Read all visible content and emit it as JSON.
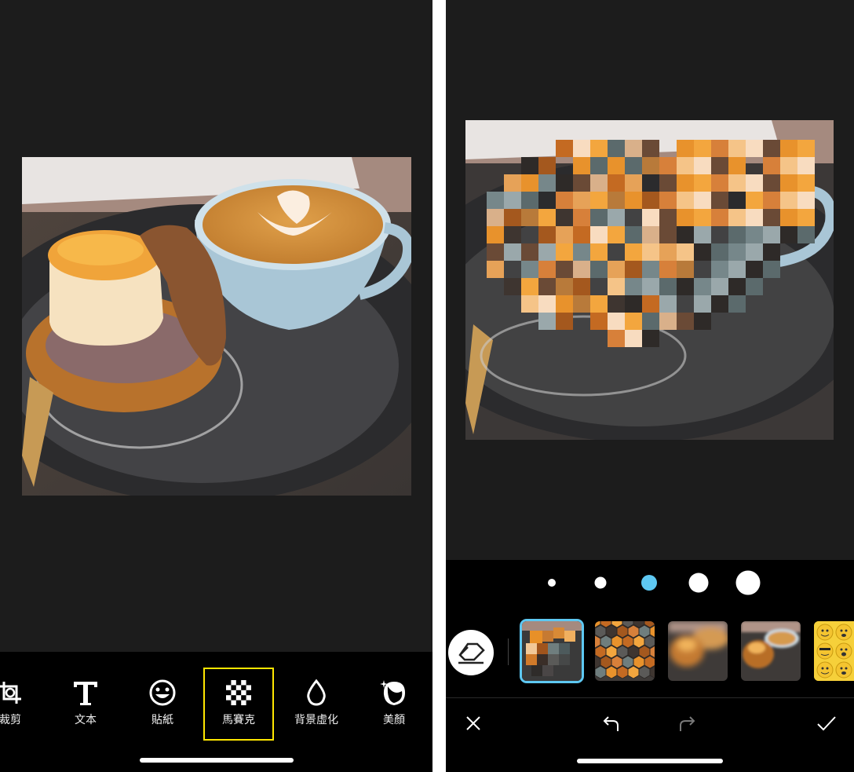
{
  "left_screen": {
    "toolbar": [
      {
        "label": "裁剪",
        "icon": "crop-icon"
      },
      {
        "label": "文本",
        "icon": "text-icon"
      },
      {
        "label": "貼紙",
        "icon": "smiley-icon"
      },
      {
        "label": "馬賽克",
        "icon": "mosaic-icon",
        "selected": true
      },
      {
        "label": "背景虛化",
        "icon": "droplet-icon"
      },
      {
        "label": "美顏",
        "icon": "face-beauty-icon"
      }
    ],
    "highlight_color": "#ffe600"
  },
  "right_screen": {
    "brush_sizes": [
      "xs",
      "s",
      "m",
      "l",
      "xl"
    ],
    "selected_brush": "m",
    "accent_color": "#5ec8f2",
    "mosaic_styles": [
      "square-mosaic",
      "hexagon-mosaic",
      "blur",
      "soft-blur",
      "emoji-pattern"
    ],
    "selected_style": "square-mosaic",
    "actions": {
      "cancel": "close-icon",
      "undo": "undo-icon",
      "redo": "redo-icon",
      "confirm": "check-icon"
    }
  }
}
